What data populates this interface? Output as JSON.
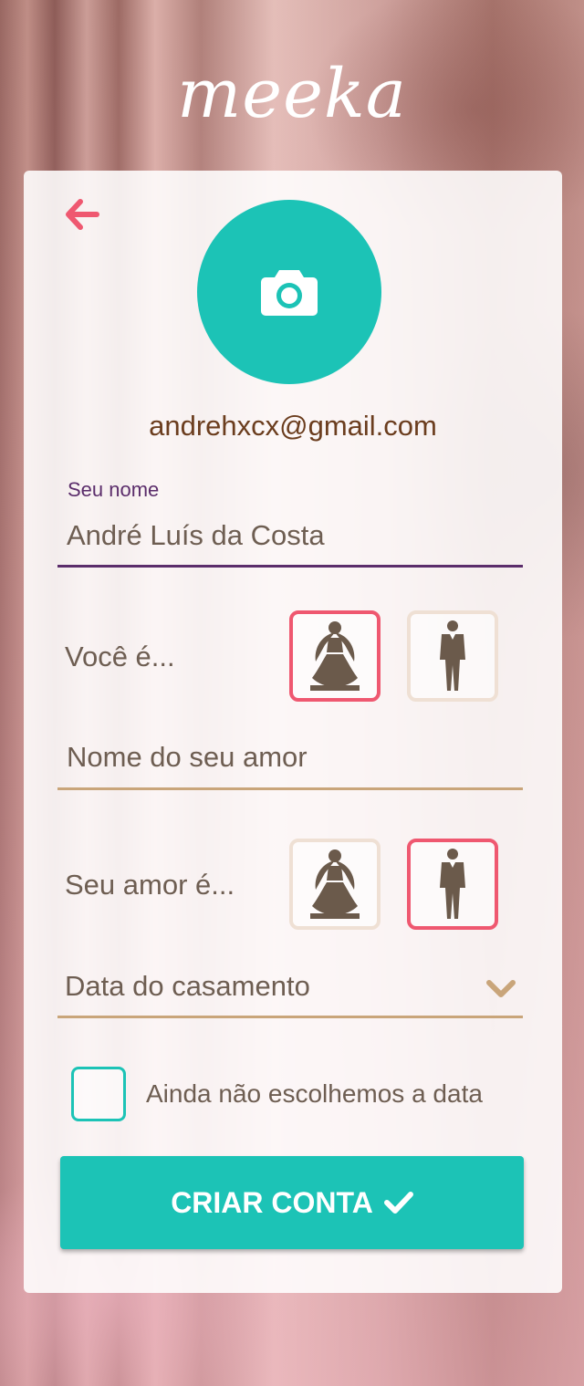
{
  "brand": {
    "logo_text": "meeka"
  },
  "profile": {
    "email": "andrehxcx@gmail.com"
  },
  "form": {
    "name_label": "Seu nome",
    "name_value": "André Luís da Costa",
    "you_are_label": "Você é...",
    "love_name_placeholder": "Nome do seu amor",
    "love_is_label": "Seu amor é...",
    "date_placeholder": "Data do casamento",
    "no_date_label": "Ainda não escolhemos a data",
    "you_are_selected": "bride",
    "love_is_selected": "groom",
    "no_date_checked": false
  },
  "actions": {
    "submit_label": "CRIAR CONTA"
  },
  "colors": {
    "accent": "#1cc3b6",
    "selected_border": "#ef5870",
    "back_arrow": "#ef5870",
    "input_focus": "#5b2d6b",
    "input_line": "#c9a57a",
    "icon": "#6b5a4b"
  },
  "icons": [
    "back-arrow-icon",
    "camera-icon",
    "bride-icon",
    "groom-icon",
    "chevron-down-icon",
    "check-icon"
  ]
}
